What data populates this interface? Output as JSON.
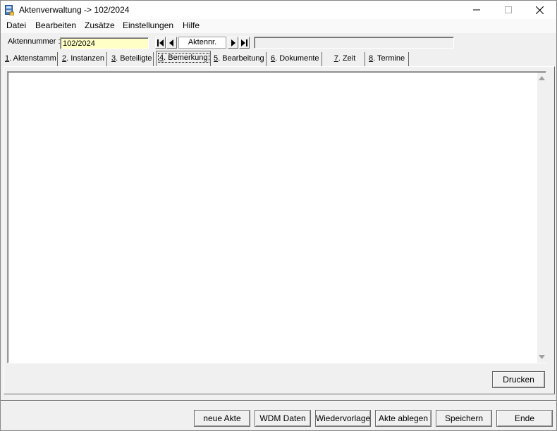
{
  "window": {
    "title": "Aktenverwaltung -> 102/2024"
  },
  "menu": {
    "items": [
      "Datei",
      "Bearbeiten",
      "Zusätze",
      "Einstellungen",
      "Hilfe"
    ]
  },
  "navrow": {
    "aktennummer_label": "Aktennummer :",
    "aktennummer_value": "102/2024",
    "nav_field_label": "Aktennr.",
    "status_text": ""
  },
  "tabs": [
    {
      "key": "1",
      "rest": ". Aktenstamm"
    },
    {
      "key": "2",
      "rest": ". Instanzen"
    },
    {
      "key": "3",
      "rest": ". Beteiligte"
    },
    {
      "key": "4",
      "rest": ". Bemerkung",
      "active": true
    },
    {
      "key": "5",
      "rest": ". Bearbeitung"
    },
    {
      "key": "6",
      "rest": ". Dokumente"
    },
    {
      "key": "7",
      "rest": ". Zeit"
    },
    {
      "key": "8",
      "rest": ". Termine"
    }
  ],
  "memo": {
    "content": ""
  },
  "buttons": {
    "drucken": "Drucken",
    "neue_akte": "neue Akte",
    "wdm_daten": "WDM Daten",
    "wiedervorlage": "Wiedervorlage",
    "akte_ablegen": "Akte ablegen",
    "speichern": "Speichern",
    "ende": "Ende"
  },
  "colors": {
    "input_yellow": "#ffffc6",
    "window_bg": "#f0f0f0"
  }
}
